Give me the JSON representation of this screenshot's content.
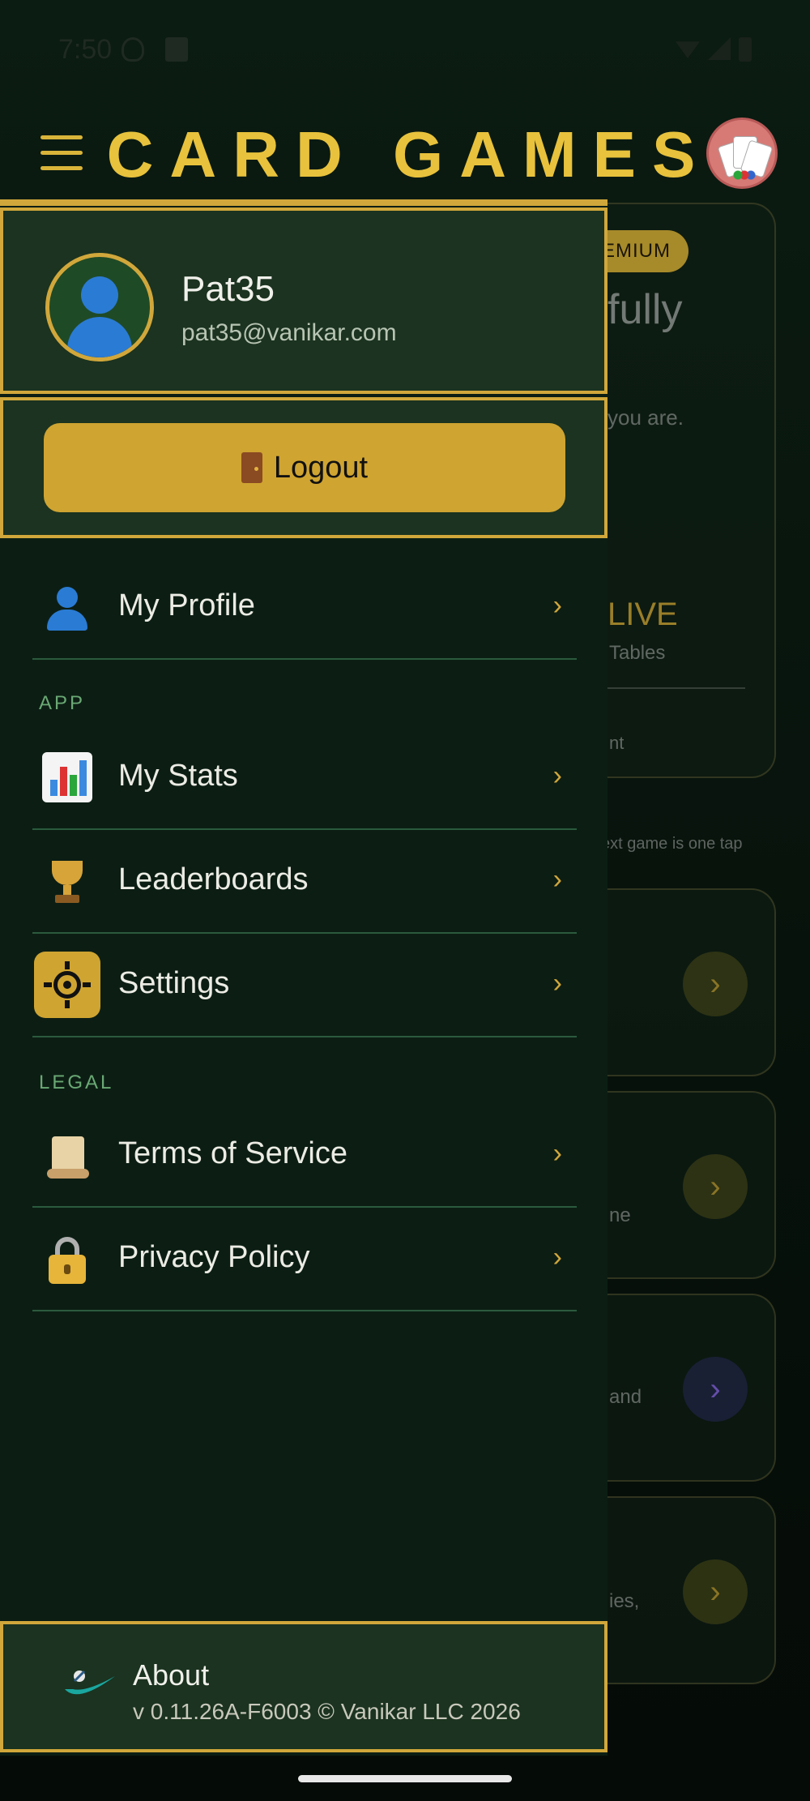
{
  "status_bar": {
    "time": "7:50"
  },
  "header": {
    "title": "CARD GAMES"
  },
  "background": {
    "premium_badge": "EMIUM",
    "headline_fragment": "fully",
    "subtitle_fragment": "you are.",
    "live_label": "LIVE",
    "tables_label": "Tables",
    "fragment_nt": "nt",
    "next_game_fragment": "ext game is one tap",
    "card_fragment_me": "ne",
    "card_fragment_and": "and",
    "card_fragment_ies": "ies,"
  },
  "drawer": {
    "user": {
      "name": "Pat35",
      "email": "pat35@vanikar.com"
    },
    "logout_label": "Logout",
    "sections": {
      "app": "APP",
      "legal": "LEGAL"
    },
    "items": {
      "profile": "My Profile",
      "stats": "My Stats",
      "leaderboards": "Leaderboards",
      "settings": "Settings",
      "terms": "Terms of Service",
      "privacy": "Privacy Policy"
    },
    "chevron": "›",
    "about": {
      "title": "About",
      "version": "v 0.11.26A-F6003  ©  Vanikar LLC 2026"
    }
  },
  "colors": {
    "accent": "#d1a73b",
    "drawer_bg": "#0c1e14",
    "panel_bg": "#1b3320",
    "divider": "#2b5a3d"
  }
}
